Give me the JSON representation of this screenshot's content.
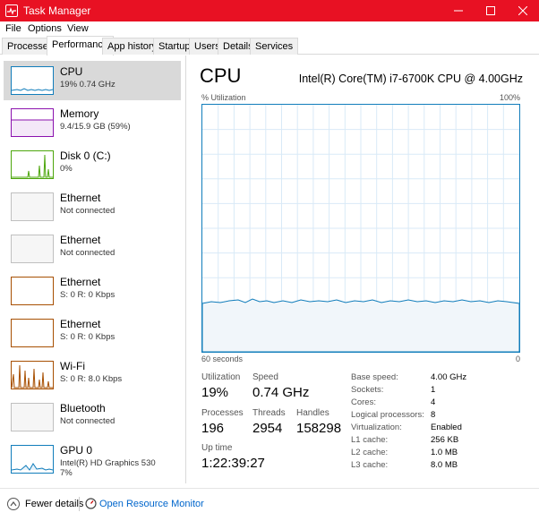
{
  "window": {
    "title": "Task Manager"
  },
  "menu": [
    "File",
    "Options",
    "View"
  ],
  "tabs": [
    "Processes",
    "Performance",
    "App history",
    "Startup",
    "Users",
    "Details",
    "Services"
  ],
  "active_tab": "Performance",
  "sidebar": {
    "items": [
      {
        "name": "CPU",
        "sub": "19%  0.74 GHz",
        "color": "#117dbb",
        "selected": true
      },
      {
        "name": "Memory",
        "sub": "9.4/15.9 GB (59%)",
        "color": "#8b12ae"
      },
      {
        "name": "Disk 0 (C:)",
        "sub": "0%",
        "color": "#4da60c"
      },
      {
        "name": "Ethernet",
        "sub": "Not connected",
        "color": "#c0c0c0"
      },
      {
        "name": "Ethernet",
        "sub": "Not connected",
        "color": "#c0c0c0"
      },
      {
        "name": "Ethernet",
        "sub": "S: 0  R: 0 Kbps",
        "color": "#a74f01"
      },
      {
        "name": "Ethernet",
        "sub": "S: 0  R: 0 Kbps",
        "color": "#a74f01"
      },
      {
        "name": "Wi-Fi",
        "sub": "S: 0  R: 8.0 Kbps",
        "color": "#a74f01"
      },
      {
        "name": "Bluetooth",
        "sub": "Not connected",
        "color": "#c0c0c0"
      },
      {
        "name": "GPU 0",
        "sub": "Intel(R) HD Graphics 530",
        "sub2": "7%",
        "color": "#117dbb"
      }
    ]
  },
  "main": {
    "title": "CPU",
    "model": "Intel(R) Core(TM) i7-6700K CPU @ 4.00GHz",
    "graph_top_left": "% Utilization",
    "graph_top_right": "100%",
    "graph_bottom_left": "60 seconds",
    "graph_bottom_right": "0",
    "stats": {
      "utilization_label": "Utilization",
      "utilization_value": "19%",
      "speed_label": "Speed",
      "speed_value": "0.74 GHz",
      "processes_label": "Processes",
      "processes_value": "196",
      "threads_label": "Threads",
      "threads_value": "2954",
      "handles_label": "Handles",
      "handles_value": "158298",
      "uptime_label": "Up time",
      "uptime_value": "1:22:39:27"
    },
    "details": [
      {
        "label": "Base speed:",
        "value": "4.00 GHz"
      },
      {
        "label": "Sockets:",
        "value": "1"
      },
      {
        "label": "Cores:",
        "value": "4"
      },
      {
        "label": "Logical processors:",
        "value": "8"
      },
      {
        "label": "Virtualization:",
        "value": "Enabled"
      },
      {
        "label": "L1 cache:",
        "value": "256 KB"
      },
      {
        "label": "L2 cache:",
        "value": "1.0 MB"
      },
      {
        "label": "L3 cache:",
        "value": "8.0 MB"
      }
    ]
  },
  "footer": {
    "fewer_details": "Fewer details",
    "resource_monitor": "Open Resource Monitor"
  },
  "colors": {
    "titlebar": "#e81123",
    "cpu_line": "#117dbb",
    "link": "#0066cc"
  }
}
